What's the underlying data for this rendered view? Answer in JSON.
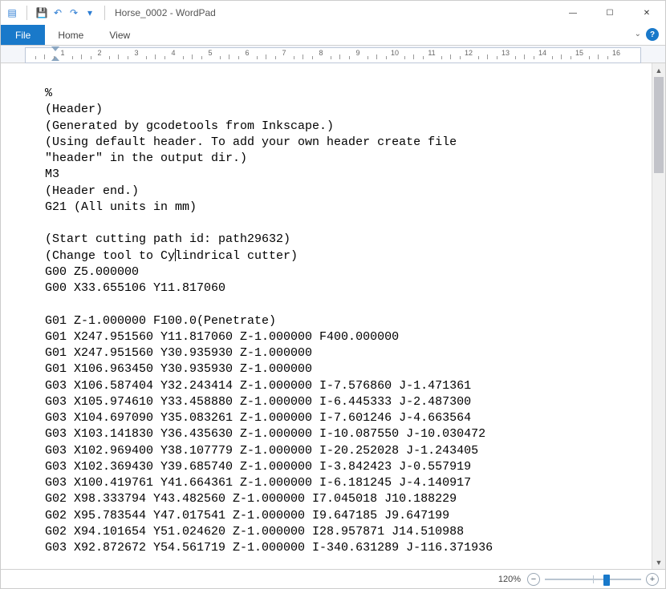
{
  "window": {
    "title": "Horse_0002 - WordPad"
  },
  "qat": {
    "app_glyph": "▤",
    "save_glyph": "💾",
    "undo_glyph": "↶",
    "redo_glyph": "↷",
    "customize_glyph": "▾"
  },
  "tabs": {
    "file": "File",
    "home": "Home",
    "view": "View"
  },
  "ruler": {
    "numbers": [
      "1",
      "2",
      "3",
      "4",
      "5",
      "6",
      "7",
      "8",
      "9",
      "10",
      "11",
      "12",
      "13",
      "14",
      "15",
      "16"
    ]
  },
  "document": {
    "lines": [
      "%",
      "(Header)",
      "(Generated by gcodetools from Inkscape.)",
      "(Using default header. To add your own header create file",
      "\"header\" in the output dir.)",
      "M3",
      "(Header end.)",
      "G21 (All units in mm)",
      "",
      "(Start cutting path id: path29632)",
      "",
      "",
      "G00 Z5.000000",
      "G00 X33.655106 Y11.817060",
      "",
      "G01 Z-1.000000 F100.0(Penetrate)",
      "G01 X247.951560 Y11.817060 Z-1.000000 F400.000000",
      "G01 X247.951560 Y30.935930 Z-1.000000",
      "G01 X106.963450 Y30.935930 Z-1.000000",
      "G03 X106.587404 Y32.243414 Z-1.000000 I-7.576860 J-1.471361",
      "G03 X105.974610 Y33.458880 Z-1.000000 I-6.445333 J-2.487300",
      "G03 X104.697090 Y35.083261 Z-1.000000 I-7.601246 J-4.663564",
      "G03 X103.141830 Y36.435630 Z-1.000000 I-10.087550 J-10.030472",
      "G03 X102.969400 Y38.107779 Z-1.000000 I-20.252028 J-1.243405",
      "G03 X102.369430 Y39.685740 Z-1.000000 I-3.842423 J-0.557919",
      "G03 X100.419761 Y41.664361 Z-1.000000 I-6.181245 J-4.140917",
      "G02 X98.333794 Y43.482560 Z-1.000000 I7.045018 J10.188229",
      "G02 X95.783544 Y47.017541 Z-1.000000 I9.647185 J9.647199",
      "G02 X94.101654 Y51.024620 Z-1.000000 I28.957871 J14.510988",
      "G03 X92.872672 Y54.561719 Z-1.000000 I-340.631289 J-116.371936"
    ],
    "caret_line": {
      "before": "(Change tool to Cy",
      "after": "lindrical cutter)"
    }
  },
  "status": {
    "zoom_label": "120%",
    "minus": "−",
    "plus": "+"
  },
  "winctl": {
    "min": "—",
    "max": "☐",
    "close": "✕"
  }
}
